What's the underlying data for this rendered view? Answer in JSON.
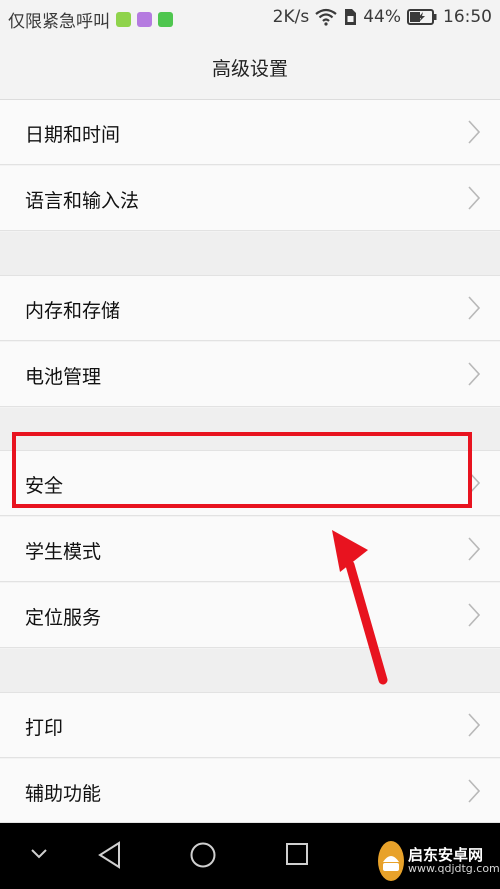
{
  "status_bar": {
    "carrier": "仅限紧急呼叫",
    "speed": "2K/s",
    "battery_percent": "44%",
    "time": "16:50"
  },
  "header": {
    "title": "高级设置"
  },
  "sections": [
    {
      "items": [
        {
          "label": "日期和时间"
        },
        {
          "label": "语言和输入法"
        }
      ]
    },
    {
      "items": [
        {
          "label": "内存和存储"
        },
        {
          "label": "电池管理"
        }
      ]
    },
    {
      "items": [
        {
          "label": "安全"
        },
        {
          "label": "学生模式"
        },
        {
          "label": "定位服务"
        }
      ]
    },
    {
      "items": [
        {
          "label": "打印"
        },
        {
          "label": "辅助功能"
        }
      ]
    }
  ],
  "annotation": {
    "highlight_target": "安全",
    "color": "#e8131f"
  },
  "watermark": {
    "title": "启东安卓网",
    "url": "www.qdjdtg.com"
  },
  "nav_icons": [
    "chevron-down-icon",
    "back-icon",
    "home-icon",
    "recents-icon"
  ]
}
